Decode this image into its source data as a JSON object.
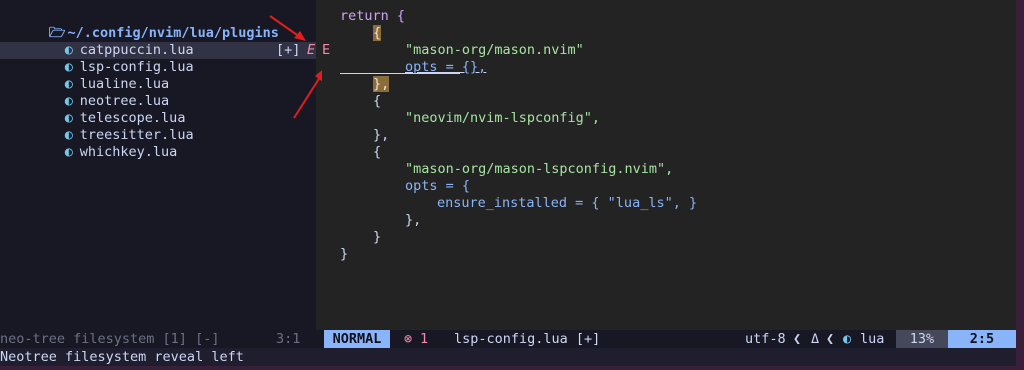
{
  "tree": {
    "root": "~/.config/nvim/lua/plugins",
    "files": [
      {
        "name": "catppuccin.lua"
      },
      {
        "name": "lsp-config.lua"
      },
      {
        "name": "lualine.lua"
      },
      {
        "name": "neotree.lua"
      },
      {
        "name": "telescope.lua"
      },
      {
        "name": "treesitter.lua"
      },
      {
        "name": "whichkey.lua"
      }
    ],
    "modified_marker": "[+]",
    "error_marker": "E",
    "editor_error_sign": "E"
  },
  "editor": {
    "lines": [
      "return {",
      "{",
      "\"mason-org/mason.nvim\"",
      "opts = {},",
      "},",
      "{",
      "\"neovim/nvim-lspconfig\",",
      "},",
      "{",
      "\"mason-org/mason-lspconfig.nvim\",",
      "opts = {",
      "ensure_installed = { \"lua_ls\", }",
      "},",
      "}",
      "}"
    ]
  },
  "status": {
    "left_label": "neo-tree filesystem [1] [-]",
    "left_pos": "3:1",
    "mode": "NORMAL",
    "diag_icon": "⊗",
    "diag_count": "1",
    "filename": "lsp-config.lua [+]",
    "encoding": "utf-8",
    "os_icon": "Δ",
    "filetype_icon": "◐",
    "filetype": "lua",
    "percent": "13%",
    "cursor": "2:5",
    "colors": {
      "mode_bg": "#89b4fa",
      "cursor_bg": "#89b4fa",
      "percent_bg": "#45475a"
    }
  },
  "cmdline": "Neotree filesystem reveal left",
  "icons": {
    "folder": "folder-open-icon",
    "file": "lua-file-icon"
  }
}
